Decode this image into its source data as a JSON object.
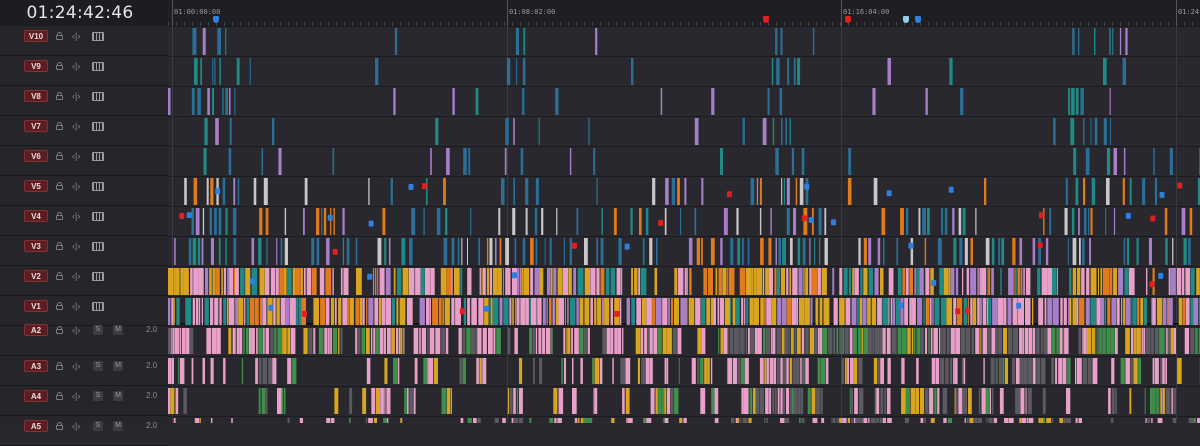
{
  "timecode": "01:24:42:46",
  "ruler": {
    "labels": [
      "01:00:00:00",
      "01:08:02:00",
      "01:16:04:00",
      "01:24:"
    ]
  },
  "video_tracks": [
    {
      "name": "V10"
    },
    {
      "name": "V9"
    },
    {
      "name": "V8"
    },
    {
      "name": "V7"
    },
    {
      "name": "V6"
    },
    {
      "name": "V5"
    },
    {
      "name": "V4"
    },
    {
      "name": "V3"
    },
    {
      "name": "V2"
    },
    {
      "name": "V1"
    }
  ],
  "audio_tracks": [
    {
      "name": "A2",
      "solo": "S",
      "mute": "M",
      "volume": "2.0"
    },
    {
      "name": "A3",
      "solo": "S",
      "mute": "M",
      "volume": "2.0"
    },
    {
      "name": "A4",
      "solo": "S",
      "mute": "M",
      "volume": "2.0"
    },
    {
      "name": "A5",
      "solo": "S",
      "mute": "M",
      "volume": "2.0"
    }
  ],
  "colors": {
    "clip_blue": "#2a6f96",
    "clip_teal": "#1f8a86",
    "clip_pink": "#e8a0c8",
    "clip_gold": "#d9a521",
    "clip_orange": "#e07a1c",
    "clip_purple": "#a77fc8",
    "clip_gray": "#5a5a60",
    "marker_red": "#e02020",
    "marker_blue": "#2f7fe0",
    "marker_cyan": "#8fd0f0",
    "track_name_bg": "#5a1e22"
  }
}
